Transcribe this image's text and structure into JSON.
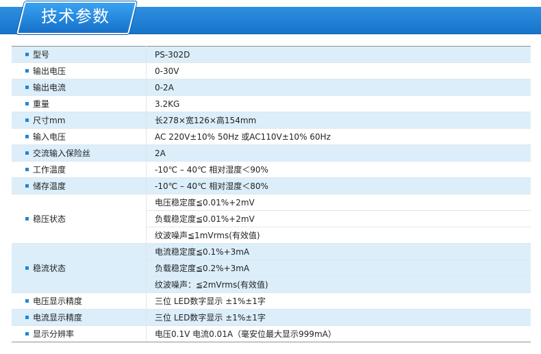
{
  "header": {
    "title": "技术参数"
  },
  "specs": [
    {
      "label": "型号",
      "value": "PS-302D"
    },
    {
      "label": "输出电压",
      "value": "0-30V"
    },
    {
      "label": "输出电流",
      "value": "0-2A"
    },
    {
      "label": "重量",
      "value": "3.2KG"
    },
    {
      "label": "尺寸mm",
      "value": "长278×宽126×高154mm"
    },
    {
      "label": "输入电压",
      "value": "AC 220V±10% 50Hz 或AC110V±10% 60Hz"
    },
    {
      "label": "交流输入保险丝",
      "value": "2A"
    },
    {
      "label": "工作温度",
      "value": "-10℃ – 40℃ 相对湿度＜90%"
    },
    {
      "label": "储存温度",
      "value": "-10℃ – 40℃ 相对湿度＜80%"
    },
    {
      "label": "稳压状态",
      "values": [
        "电压稳定度≦0.01%+2mV",
        "负载稳定度≦0.01%+2mV",
        "纹波噪声≦1mVrms(有效值)"
      ]
    },
    {
      "label": "稳流状态",
      "values": [
        "电流稳定度≦0.1%+3mA",
        "负载稳定度≦0.2%+3mA",
        "纹波噪声：≦2mVrms(有效值)"
      ]
    },
    {
      "label": "电压显示精度",
      "value": "三位 LED数字显示 ±1%±1字"
    },
    {
      "label": "电流显示精度",
      "value": "三位 LED数字显示 ±1%±1字"
    },
    {
      "label": "显示分辨率",
      "value": "电压0.1V 电流0.01A（毫安位最大显示999mA）"
    }
  ],
  "colors": {
    "accent": "#1f86d8",
    "row_blue": "#dbeefa",
    "banner": "#1673c9"
  }
}
